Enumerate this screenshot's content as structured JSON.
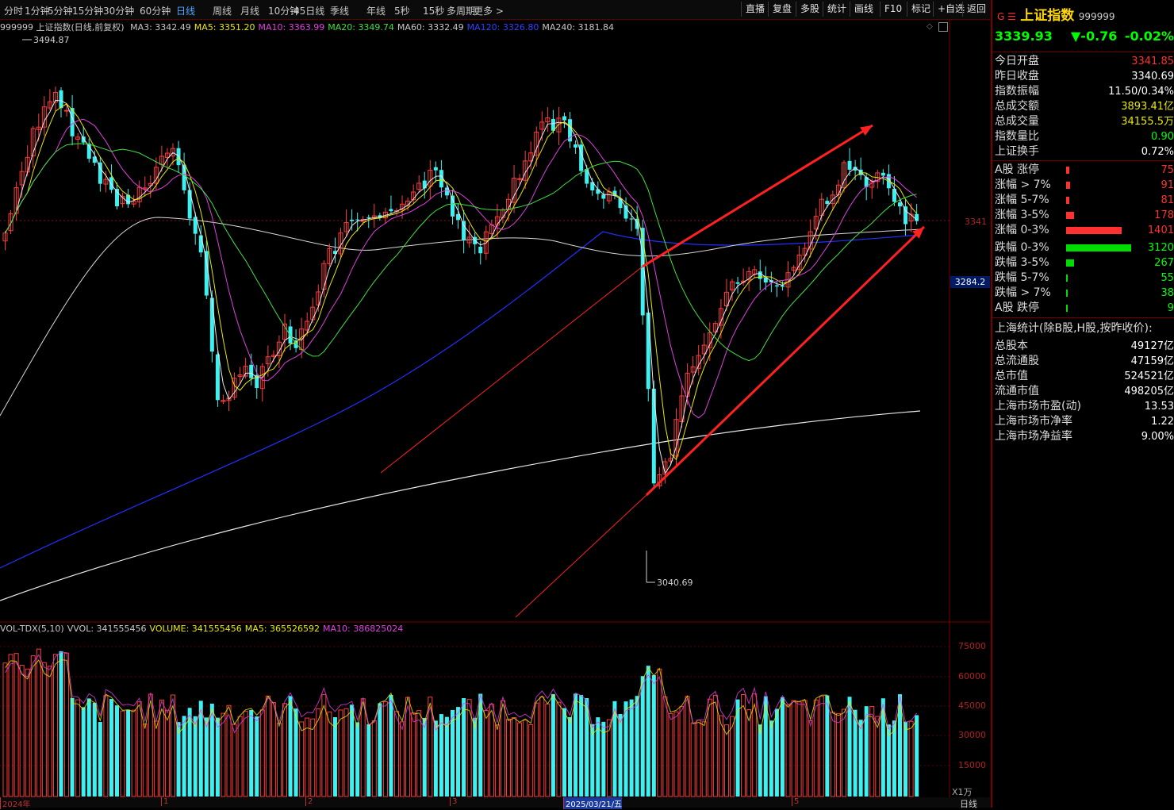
{
  "toolbar": {
    "periods": [
      "分时",
      "1分钟",
      "5分钟",
      "15分钟",
      "30分钟",
      "60分钟",
      "日线",
      "周线",
      "月线",
      "10分钟",
      "45日线",
      "季线",
      "年线",
      "5秒",
      "15秒",
      "多周期",
      "更多 >"
    ],
    "active_period": "日线",
    "tools": [
      "直播",
      "复盘",
      "多股",
      "统计",
      "画线",
      "F10",
      "标记",
      "+自选",
      "返回"
    ]
  },
  "ma_legend": {
    "title": "999999 上证指数(日线,前复权)",
    "items": [
      {
        "label": "MA3: 3342.49",
        "color": "#c8c8c8"
      },
      {
        "label": "MA5: 3351.20",
        "color": "#e8e800"
      },
      {
        "label": "MA10: 3363.99",
        "color": "#e040e0"
      },
      {
        "label": "MA20: 3349.74",
        "color": "#40e040"
      },
      {
        "label": "MA60: 3332.49",
        "color": "#c8c8c8"
      },
      {
        "label": "MA120: 3326.80",
        "color": "#3040ff"
      },
      {
        "label": "MA240: 3181.84",
        "color": "#c8c8c8"
      }
    ]
  },
  "price_tags": {
    "high": "3494.87",
    "low": "3040.69",
    "current_line": "3341",
    "cursor": "3284.2"
  },
  "vol_legend": {
    "items": [
      {
        "label": "VOL-TDX(5,10)",
        "color": "#c8c8c8"
      },
      {
        "label": "VVOL: 341555456",
        "color": "#c8c8c8"
      },
      {
        "label": "VOLUME: 341555456",
        "color": "#e8e800"
      },
      {
        "label": "MA5: 365526592",
        "color": "#e8e800"
      },
      {
        "label": "MA10: 386825024",
        "color": "#e040e0"
      }
    ],
    "ticks": [
      "75000",
      "60000",
      "45000",
      "30000",
      "15000"
    ],
    "unit": "X1万"
  },
  "time_axis": {
    "labels": [
      "2024年",
      "1",
      "2",
      "3",
      "2025/03/21/五",
      "5"
    ],
    "right_label": "日线"
  },
  "chart_data": {
    "type": "candlestick",
    "title": "999999 上证指数(日线,前复权)",
    "ylim": [
      3040.69,
      3494.87
    ],
    "volume_ylim": [
      0,
      75000
    ],
    "note_values": {
      "high": 3494.87,
      "low": 3040.69
    }
  },
  "quote": {
    "marker": "G ☰",
    "name": "上证指数",
    "code": "999999",
    "price": "3339.93",
    "change": "▼-0.76",
    "change_pct": "-0.02%"
  },
  "stats": [
    {
      "label": "今日开盘",
      "value": "3341.85",
      "color": "#ff3030"
    },
    {
      "label": "昨日收盘",
      "value": "3340.69",
      "color": "#ffffff"
    },
    {
      "label": "指数振幅",
      "value": "11.50/0.34%",
      "color": "#ffffff"
    },
    {
      "label": "总成交额",
      "value": "3893.41亿",
      "color": "#e8e800"
    },
    {
      "label": "总成交量",
      "value": "34155.5万",
      "color": "#e8e800"
    },
    {
      "label": "指数量比",
      "value": "0.90",
      "color": "#00ff00"
    },
    {
      "label": "上证换手",
      "value": "0.72%",
      "color": "#ffffff"
    }
  ],
  "breadth_up": [
    {
      "label": "A股 涨停",
      "value": "75",
      "bar": 0.05
    },
    {
      "label": "涨幅 > 7%",
      "value": "91",
      "bar": 0.06
    },
    {
      "label": "涨幅 5-7%",
      "value": "81",
      "bar": 0.05
    },
    {
      "label": "涨幅 3-5%",
      "value": "178",
      "bar": 0.12
    },
    {
      "label": "涨幅 0-3%",
      "value": "1401",
      "bar": 0.85
    }
  ],
  "breadth_down": [
    {
      "label": "跌幅 0-3%",
      "value": "3120",
      "bar": 1.0
    },
    {
      "label": "跌幅 3-5%",
      "value": "267",
      "bar": 0.12
    },
    {
      "label": "跌幅 5-7%",
      "value": "55",
      "bar": 0.03
    },
    {
      "label": "跌幅 > 7%",
      "value": "38",
      "bar": 0.03
    },
    {
      "label": "A股 跌停",
      "value": "9",
      "bar": 0.02
    }
  ],
  "market": {
    "header": "上海统计(除B股,H股,按昨收价):",
    "rows": [
      {
        "label": "总股本",
        "value": "49127亿"
      },
      {
        "label": "总流通股",
        "value": "47159亿"
      },
      {
        "label": "总市值",
        "value": "524521亿"
      },
      {
        "label": "流通市值",
        "value": "498205亿"
      },
      {
        "label": "上海市场市盈(动)",
        "value": "13.53"
      },
      {
        "label": "上海市场市净率",
        "value": "1.22"
      },
      {
        "label": "上海市场净益率",
        "value": "9.00%"
      }
    ]
  },
  "colors": {
    "up": "#ff3c3c",
    "down": "#3ff0f0",
    "accent": "#ffd700"
  }
}
